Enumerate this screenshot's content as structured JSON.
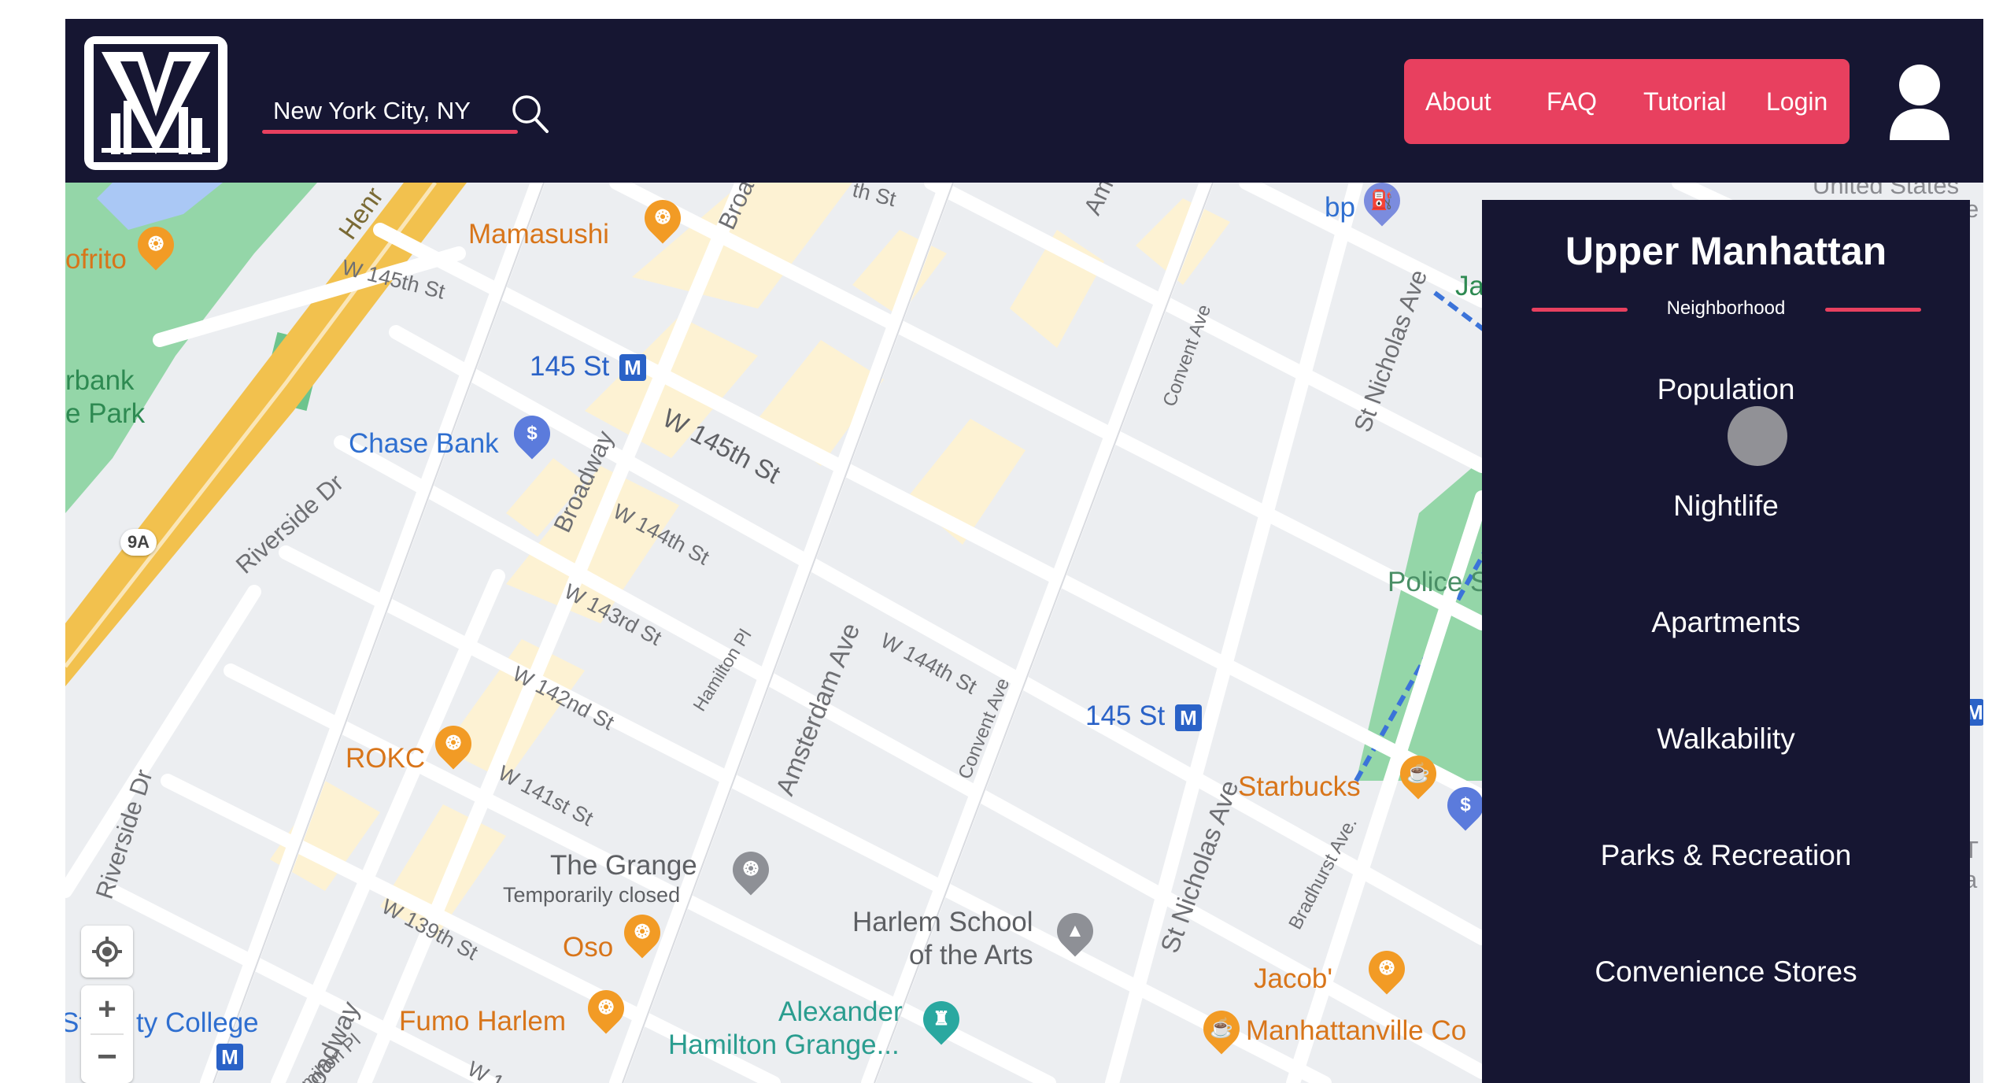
{
  "header": {
    "search": {
      "value": "New York City, NY",
      "placeholder": ""
    },
    "nav": {
      "about": "About",
      "faq": "FAQ",
      "tutorial": "Tutorial",
      "login": "Login"
    }
  },
  "panel": {
    "title": "Upper Manhattan",
    "subtitle": "Neighborhood",
    "categories": [
      "Population",
      "Nightlife",
      "Apartments",
      "Walkability",
      "Parks & Recreation",
      "Convenience Stores"
    ]
  },
  "map": {
    "labels": {
      "mamasushi": "Mamasushi",
      "ofrito": "ofrito",
      "w145_top": "W 145th St",
      "w145_main": "W 145th St",
      "w144_a": "W 144th St",
      "w144_b": "W 144th St",
      "w143": "W 143rd St",
      "w142": "W 142nd St",
      "w141": "W 141st St",
      "w139": "W 139th St",
      "broadway_top": "Broa",
      "broadway_mid": "Broadway",
      "broadway_bot": "Broadway",
      "amsterdam_top": "Am",
      "amsterdam": "Amsterdam Ave",
      "riverside_dr": "Riverside Dr",
      "riverside_dr2": "Riverside Dr",
      "riverbank_1": "rbank",
      "riverbank_2": "e Park",
      "henry": "Henr",
      "chase": "Chase Bank",
      "station_145_a": "145 St",
      "station_145_b": "145 St",
      "rokc": "ROKC",
      "grange": "The Grange",
      "grange_status": "Temporarily closed",
      "oso": "Oso",
      "fumo": "Fumo Harlem",
      "harlem_school_1": "Harlem School",
      "harlem_school_2": "of the Arts",
      "alexander_1": "Alexander",
      "alexander_2": "Hamilton Grange...",
      "starbucks": "Starbucks",
      "jacob": "Jacob'",
      "manhattanville": "Manhattanville Co",
      "police": "Police S",
      "st_nicholas_top": "St Nicholas Ave",
      "st_nicholas_bot": "St Nicholas Ave",
      "convent_top": "Convent Ave",
      "convent_bot": "Convent Ave",
      "bradhurst": "Bradhurst Ave.",
      "hamilton_pl": "Hamilton Pl",
      "hamilton_pl2": "amilton Pl",
      "city_college": "ty College",
      "city_college_prefix": "St",
      "bp": "bp",
      "ja": "Ja",
      "united_states": "United States",
      "route": "9A",
      "w_bottom": "W 1",
      "hst_top": "th St",
      "edge_t": "T",
      "edge_a": "a",
      "edge_e": "e"
    }
  },
  "colors": {
    "navbar": "#161632",
    "accent": "#e8405f",
    "panel": "#161632",
    "map_background": "#eceef1",
    "park": "#94d6a8",
    "highway": "#f2c14e",
    "building_yellow": "#fdf2d3"
  },
  "icons": {
    "search": "search-icon",
    "user": "user-avatar-icon",
    "logo": "skyline-logo"
  }
}
